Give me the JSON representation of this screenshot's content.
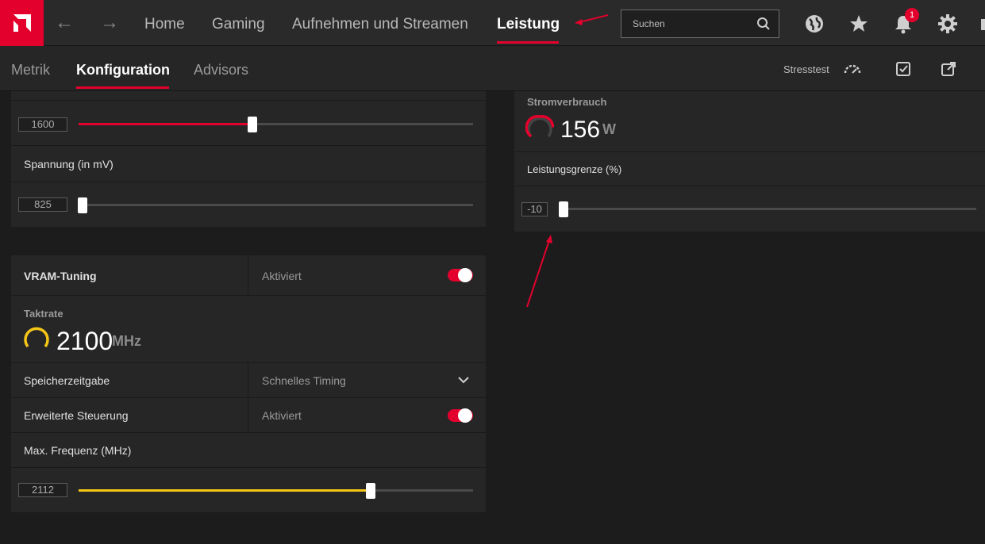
{
  "nav": {
    "home": "Home",
    "gaming": "Gaming",
    "record": "Aufnehmen und Streamen",
    "performance": "Leistung",
    "search_placeholder": "Suchen",
    "notification_count": "1"
  },
  "subnav": {
    "metrics": "Metrik",
    "config": "Konfiguration",
    "advisors": "Advisors",
    "stresstest": "Stresstest"
  },
  "gpu_panel": {
    "clock_value": "1600",
    "clock_fill_fraction": 0.44,
    "voltage_label": "Spannung (in mV)",
    "voltage_value": "825",
    "voltage_fill_fraction": 0.01
  },
  "vram_panel": {
    "title": "VRAM-Tuning",
    "status": "Aktiviert",
    "clock_label": "Taktrate",
    "clock_value": "2100",
    "clock_unit": "MHz",
    "timing_label": "Speicherzeitgabe",
    "timing_value": "Schnelles Timing",
    "advanced_label": "Erweiterte Steuerung",
    "advanced_status": "Aktiviert",
    "maxfreq_label": "Max. Frequenz (MHz)",
    "maxfreq_value": "2112",
    "maxfreq_fill_fraction": 0.74
  },
  "power_panel": {
    "power_label": "Stromverbrauch",
    "power_value": "156",
    "power_unit": "W",
    "limit_label": "Leistungsgrenze (%)",
    "limit_value": "-10",
    "limit_fill_fraction": 0.0
  },
  "colors": {
    "accent": "#e3002d",
    "vram_accent": "#f5c518"
  }
}
